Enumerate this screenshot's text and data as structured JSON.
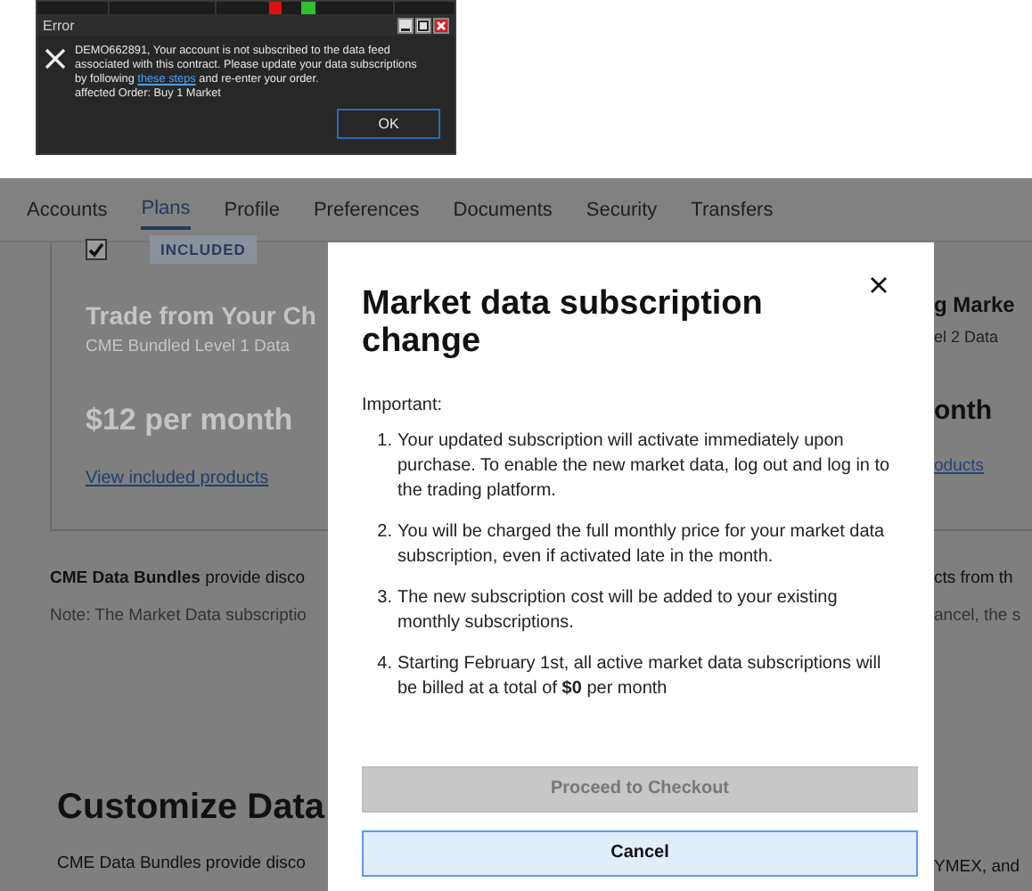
{
  "error_dialog": {
    "title": "Error",
    "message_before": "DEMO662891, Your account is not subscribed to the data feed associated with this contract. Please update your data subscriptions by following",
    "link": "these steps",
    "message_after": "and re-enter your order.",
    "order_line": "affected Order: Buy 1 Market",
    "ok_button": "OK"
  },
  "tabs": [
    {
      "label": "Accounts",
      "selected": false
    },
    {
      "label": "Plans",
      "selected": true
    },
    {
      "label": "Profile",
      "selected": false
    },
    {
      "label": "Preferences",
      "selected": false
    },
    {
      "label": "Documents",
      "selected": false
    },
    {
      "label": "Security",
      "selected": false
    },
    {
      "label": "Transfers",
      "selected": false
    }
  ],
  "plan_card": {
    "checked": true,
    "badge": "INCLUDED",
    "title": "Trade from Your Ch",
    "subtitle": "CME Bundled Level 1 Data",
    "price": "$12 per month",
    "link": "View included products"
  },
  "plan_card_right": {
    "title": "g Marke",
    "subtitle": "el 2 Data",
    "price": "onth",
    "link": "oducts"
  },
  "paragraphs": [
    {
      "left": "**CME Data Bundles** provide disco",
      "right": "cts from th"
    },
    {
      "left": "Note: The Market Data subscriptio",
      "right": "ancel, the s"
    }
  ],
  "section_heading": "Customize Data",
  "section_text": {
    "left": "CME Data Bundles provide disco",
    "right": "YMEX, and"
  },
  "modal": {
    "title": "Market data subscription change",
    "intro": "Important:",
    "items": [
      {
        "number": "1.",
        "text": "Your updated subscription will activate immediately upon purchase. To enable the new market data, log out and log in to the trading platform."
      },
      {
        "number": "2.",
        "text": "You will be charged the full monthly price for your market data subscription, even if activated late in the month."
      },
      {
        "number": "3.",
        "text": "The new subscription cost will be added to your existing monthly subscriptions."
      },
      {
        "number": "4.",
        "text": "Starting February 1st, all active market data subscriptions will be billed at a total of **$0** per month"
      }
    ],
    "primary_button": {
      "label": "Proceed to Checkout",
      "disabled": true
    },
    "cancel_button": "Cancel"
  }
}
